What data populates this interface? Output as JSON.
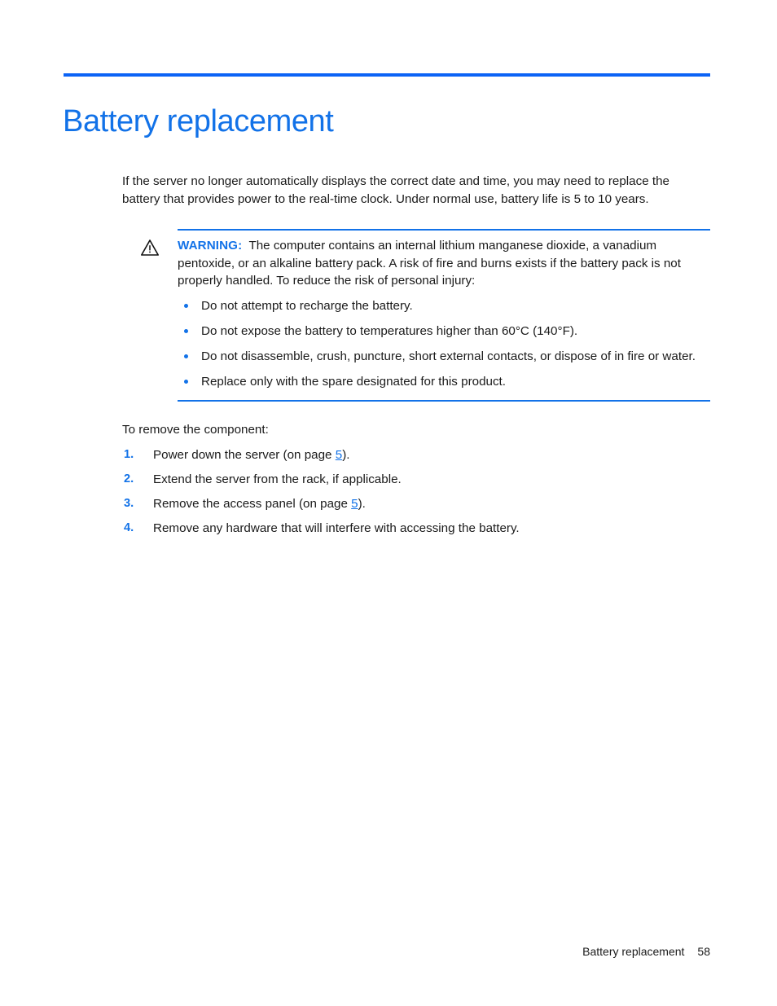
{
  "document": {
    "title": "Battery replacement",
    "accent_color": "#1272e8",
    "rule_color": "#0b63f6"
  },
  "intro": {
    "text": "If the server no longer automatically displays the correct date and time, you may need to replace the battery that provides power to the real-time clock. Under normal use, battery life is 5 to 10 years."
  },
  "warning": {
    "icon": "warning-triangle-icon",
    "label": "WARNING:",
    "body": "The computer contains an internal lithium manganese dioxide, a vanadium pentoxide, or an alkaline battery pack. A risk of fire and burns exists if the battery pack is not properly handled. To reduce the risk of personal injury:",
    "items": [
      "Do not attempt to recharge the battery.",
      "Do not expose the battery to temperatures higher than 60°C (140°F).",
      "Do not disassemble, crush, puncture, short external contacts, or dispose of in fire or water.",
      "Replace only with the spare designated for this product."
    ]
  },
  "procedure": {
    "lead_in": "To remove the component:",
    "steps": [
      {
        "number": "1.",
        "text_before": "Power down the server (on page ",
        "link": "5",
        "text_after": ")."
      },
      {
        "number": "2.",
        "text_before": "Extend the server from the rack, if applicable.",
        "link": "",
        "text_after": ""
      },
      {
        "number": "3.",
        "text_before": "Remove the access panel (on page ",
        "link": "5",
        "text_after": ")."
      },
      {
        "number": "4.",
        "text_before": "Remove any hardware that will interfere with accessing the battery.",
        "link": "",
        "text_after": ""
      }
    ]
  },
  "footer": {
    "chapter": "Battery replacement",
    "page_number": "58"
  }
}
